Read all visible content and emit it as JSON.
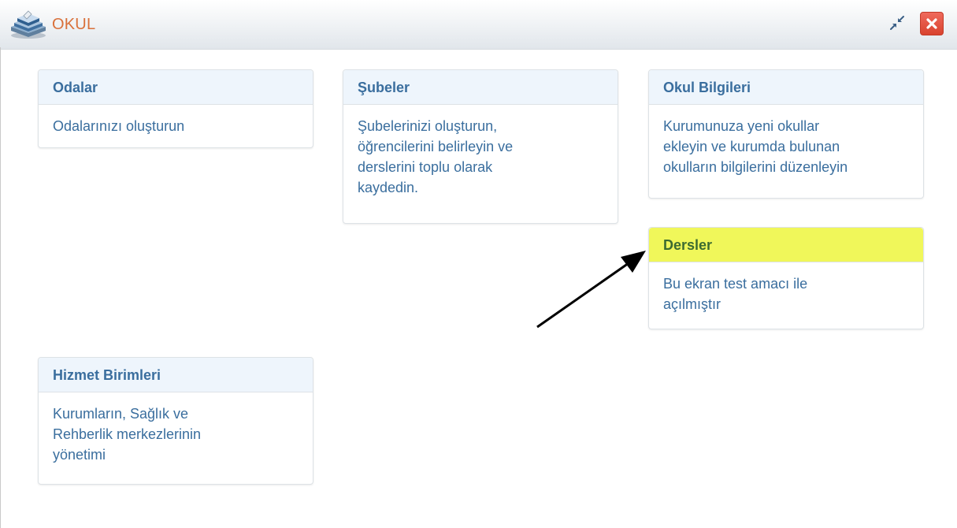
{
  "window": {
    "title": "OKUL",
    "logo_icon": "books-icon",
    "minimize_icon": "collapse-arrows-icon",
    "close_icon": "close-x-icon",
    "title_color": "#d9703a",
    "close_color": "#e2533f"
  },
  "cards": [
    {
      "title": "Odalar",
      "description": "Odalarınızı oluşturun"
    },
    {
      "title": "Şubeler",
      "description_lines": [
        "Şubelerinizi oluşturun,",
        "öğrencilerini belirleyin ve",
        "derslerini toplu olarak",
        "kaydedin."
      ]
    },
    {
      "title": "Okul Bilgileri",
      "description_lines": [
        "Kurumunuza yeni okullar",
        "ekleyin ve kurumda bulunan",
        "okulların bilgilerini düzenleyin"
      ]
    },
    {
      "title": "Dersler",
      "highlighted": true,
      "highlight_color": "#f0f75a",
      "description_lines": [
        "Bu ekran test amacı ile",
        "açılmıştır"
      ]
    },
    {
      "title": "Hizmet Birimleri",
      "description_lines": [
        "Kurumların, Sağlık ve",
        "Rehberlik merkezlerinin",
        "yönetimi"
      ]
    }
  ],
  "annotation": {
    "icon": "arrow-icon",
    "target": "Dersler"
  },
  "colors": {
    "card_header_bg": "#eef5fc",
    "card_text": "#3a6e9e",
    "highlight_text": "#3c6b31"
  }
}
